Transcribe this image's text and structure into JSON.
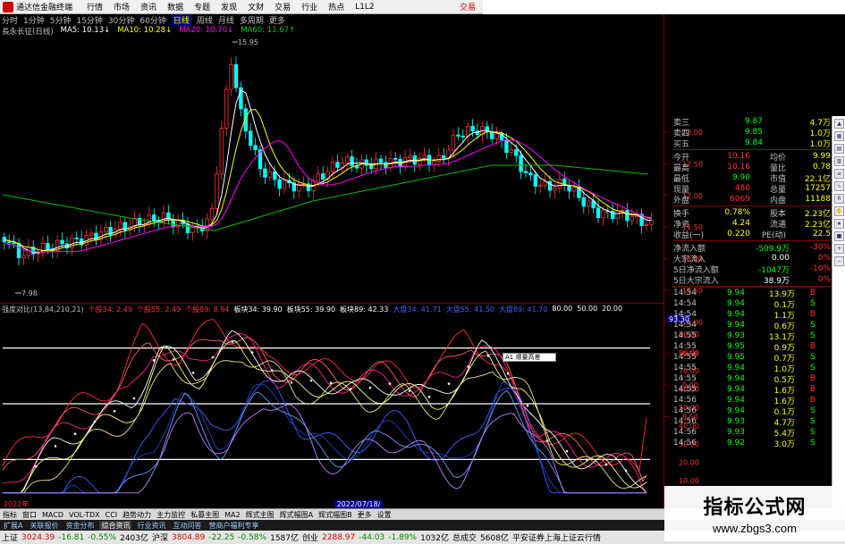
{
  "menubar": {
    "app_title": "通达信金融终端",
    "items": [
      "行情",
      "市场",
      "资讯",
      "数据",
      "专题",
      "发现",
      "文财",
      "交易",
      "行业",
      "热点",
      "L1L2"
    ],
    "trade": "交易"
  },
  "periods": {
    "items": [
      "分时",
      "1分钟",
      "5分钟",
      "15分钟",
      "30分钟",
      "60分钟",
      "日线",
      "周线",
      "月线",
      "多周期",
      "更多"
    ],
    "selected": 6
  },
  "kline_legend": {
    "name": "長永长征(日线)",
    "ma5": "MA5: 10.13↓",
    "ma10": "MA10: 10.28↓",
    "ma20": "MA20: 10.70↓",
    "ma60": "MA60: 11.67↑"
  },
  "kline_markers": {
    "high": "15.95",
    "low": "7.98"
  },
  "osc_legend": {
    "name": "强度对比(13,84,210,21)",
    "items": [
      {
        "text": "个股34: 2.49",
        "color": "#ff3030"
      },
      {
        "text": "个股55: 2.49",
        "color": "#ff3030"
      },
      {
        "text": "个股89: 8.94",
        "color": "#ff3030"
      },
      {
        "text": "板块34: 39.90",
        "color": "#ffffff"
      },
      {
        "text": "板块55: 39.90",
        "color": "#ffffff"
      },
      {
        "text": "板块89: 42.33",
        "color": "#ffffff"
      },
      {
        "text": "大盘34: 41.71",
        "color": "#4060ff"
      },
      {
        "text": "大盘55: 41.50",
        "color": "#4060ff"
      },
      {
        "text": "大盘89: 41.70",
        "color": "#4060ff"
      },
      {
        "text": "80.00",
        "color": "#ffffff"
      },
      {
        "text": "50.00",
        "color": "#ffffff"
      },
      {
        "text": "20.00",
        "color": "#ffffff"
      }
    ]
  },
  "price_axis": [
    "13.00",
    "12.50",
    "12.00",
    "11.50",
    "11.00",
    "10.50",
    "10.00",
    "9.50",
    "9.00",
    "8.50"
  ],
  "osc_axis": [
    "90.00",
    "80.00",
    "70.00",
    "60.00",
    "50.00",
    "40.00",
    "30.00",
    "20.00",
    "10.00"
  ],
  "osc_current": "93.30",
  "date_labels": {
    "start": "2022年",
    "mid": "2022/07/18/一"
  },
  "tooltip": "A1 顺量高差",
  "side": {
    "asks": [
      {
        "l": "卖三",
        "p": "9.87",
        "v": "4.7万"
      },
      {
        "l": "卖四",
        "p": "9.85",
        "v": "1.0万"
      },
      {
        "l": "买五",
        "p": "9.84",
        "v": "1.0万"
      }
    ],
    "info": [
      {
        "l1": "今开",
        "v1": "10.16",
        "l2": "均价",
        "v2": "9.99"
      },
      {
        "l1": "最高",
        "v1": "10.16",
        "l2": "量比",
        "v2": "0.78"
      },
      {
        "l1": "最低",
        "v1": "9.90",
        "l2": "市值",
        "v2": "22.1亿"
      },
      {
        "l1": "现量",
        "v1": "480",
        "l2": "总量",
        "v2": "17257"
      },
      {
        "l1": "外盘",
        "v1": "6069",
        "l2": "内盘",
        "v2": "11188"
      }
    ],
    "info2": [
      {
        "l1": "换手",
        "v1": "0.78%",
        "l2": "股本",
        "v2": "2.23亿"
      },
      {
        "l1": "净资",
        "v1": "4.24",
        "l2": "流通",
        "v2": "2.23亿"
      },
      {
        "l1": "收益(一)",
        "v1": "0.220",
        "l2": "PE(动)",
        "v2": "22.5"
      }
    ],
    "flows": [
      {
        "l": "净流入额",
        "v": "-509.9万",
        "pct": "-30%"
      },
      {
        "l": "大宗流入",
        "v": "0.00",
        "pct": "0%"
      },
      {
        "l": "5日净流入额",
        "v": "-1047万",
        "pct": "-10%"
      },
      {
        "l": "5日大宗流入",
        "v": "38.9万",
        "pct": "0%"
      }
    ],
    "ticks": [
      {
        "t": "14:54",
        "p": "9.94",
        "v": "13.9万",
        "d": "B"
      },
      {
        "t": "14:54",
        "p": "9.94",
        "v": "0.1万",
        "d": "S"
      },
      {
        "t": "14:54",
        "p": "9.94",
        "v": "1.1万",
        "d": "B"
      },
      {
        "t": "14:54",
        "p": "9.94",
        "v": "0.6万",
        "d": "S"
      },
      {
        "t": "14:55",
        "p": "9.93",
        "v": "13.1万",
        "d": "S"
      },
      {
        "t": "14:55",
        "p": "9.95",
        "v": "0.9万",
        "d": "B"
      },
      {
        "t": "14:55",
        "p": "9.95",
        "v": "0.7万",
        "d": "S"
      },
      {
        "t": "14:55",
        "p": "9.94",
        "v": "1.0万",
        "d": "S"
      },
      {
        "t": "14:55",
        "p": "9.94",
        "v": "0.5万",
        "d": "B"
      },
      {
        "t": "14:55",
        "p": "9.94",
        "v": "1.6万",
        "d": "B"
      },
      {
        "t": "14:56",
        "p": "9.94",
        "v": "1.6万",
        "d": "B"
      },
      {
        "t": "14:56",
        "p": "9.94",
        "v": "0.1万",
        "d": "S"
      },
      {
        "t": "14:56",
        "p": "9.93",
        "v": "4.7万",
        "d": "S"
      },
      {
        "t": "14:56",
        "p": "9.93",
        "v": "5.4万",
        "d": "S"
      },
      {
        "t": "14:56",
        "p": "9.92",
        "v": "3.0万",
        "d": "S"
      }
    ]
  },
  "toolbar": [
    "指标",
    "窗口",
    "MACD",
    "VOL-TDX",
    "CCI",
    "趋势动力",
    "主力监控",
    "私募主图",
    "MA2",
    "辉式主图",
    "辉式幅图A",
    "辉式幅图B",
    "更多",
    "设置"
  ],
  "tabs": {
    "items": [
      "扩展A",
      "关联报价",
      "资金分布",
      "综合资讯",
      "行业资讯",
      "互动问答",
      "营商户福利专享"
    ],
    "active": 3
  },
  "ticker": {
    "sh": {
      "name": "上证",
      "val": "3024.39",
      "chg": "-16.81",
      "pct": "-0.55%",
      "amt": "2403亿"
    },
    "sz": {
      "name": "沪深",
      "val": "3804.89",
      "chg": "-22.25",
      "pct": "-0.58%",
      "amt": "1587亿"
    },
    "cy": {
      "name": "创业",
      "val": "2288.97",
      "chg": "-44.03",
      "pct": "-1.89%",
      "amt": "1032亿"
    },
    "total_label": "总成交",
    "total": "5608亿",
    "broker": "平安证券上海上证云行情"
  },
  "watermark": {
    "title": "指标公式网",
    "url": "www.zbgs3.com"
  },
  "colors": {
    "up": "#ff3030",
    "down": "#00ffff",
    "ma5": "#ffffff",
    "ma10": "#ffff00",
    "ma20": "#ff00ff",
    "ma60": "#00c000"
  }
}
